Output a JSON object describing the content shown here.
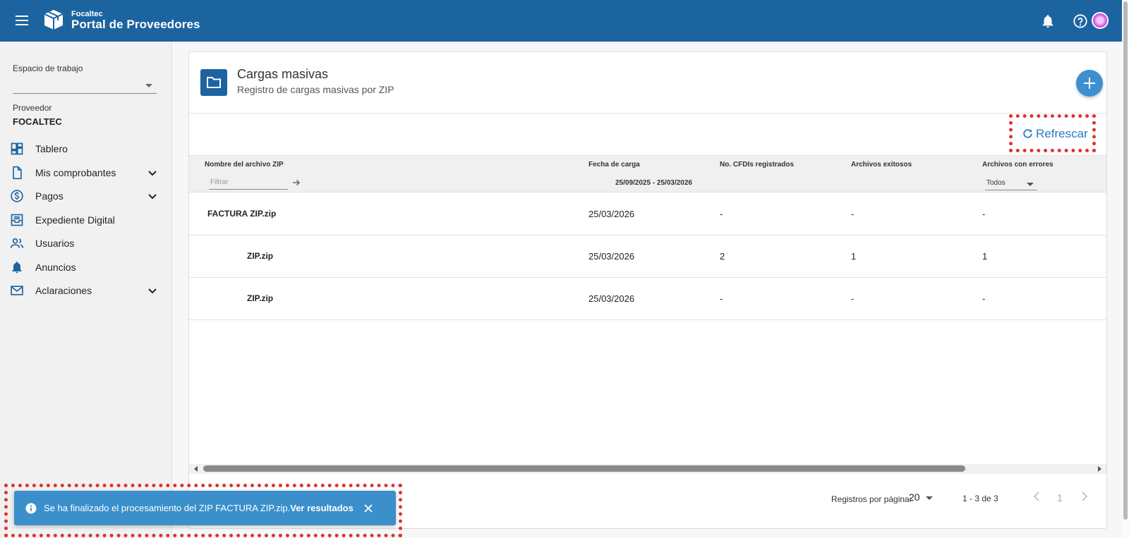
{
  "header": {
    "brand_small": "Focaltec",
    "brand_title": "Portal de Proveedores",
    "icons": [
      "menu-icon",
      "box-logo-icon",
      "bell-icon",
      "help-icon",
      "avatar"
    ]
  },
  "sidebar": {
    "workspace_label": "Espacio de trabajo",
    "workspace_value": "",
    "provider_label": "Proveedor",
    "provider_name": "FOCALTEC",
    "items": [
      {
        "label": "Tablero",
        "icon": "dashboard-icon",
        "expandable": false
      },
      {
        "label": "Mis comprobantes",
        "icon": "document-icon",
        "expandable": true
      },
      {
        "label": "Pagos",
        "icon": "dollar-coin-icon",
        "expandable": true
      },
      {
        "label": "Expediente Digital",
        "icon": "inbox-tray-icon",
        "expandable": false
      },
      {
        "label": "Usuarios",
        "icon": "users-icon",
        "expandable": false
      },
      {
        "label": "Anuncios",
        "icon": "bell-icon",
        "expandable": false
      },
      {
        "label": "Aclaraciones",
        "icon": "mail-icon",
        "expandable": true
      }
    ]
  },
  "card": {
    "title": "Cargas masivas",
    "subtitle": "Registro de cargas masivas por ZIP",
    "refresh_label": "Refrescar"
  },
  "table": {
    "columns": [
      "Nombre del archivo ZIP",
      "Fecha de carga",
      "No. CFDIs registrados",
      "Archivos exitosos",
      "Archivos con errores"
    ],
    "filter_placeholder": "Filtrar",
    "date_filter": "25/09/2025 - 25/03/2026",
    "errors_filter": "Todos",
    "rows": [
      {
        "name": "FACTURA ZIP.zip",
        "date": "25/03/2026",
        "cfdis": "-",
        "ok": "-",
        "errors": "-"
      },
      {
        "name": "ZIP.zip",
        "date": "25/03/2026",
        "cfdis": "2",
        "ok": "1",
        "errors": "1"
      },
      {
        "name": "ZIP.zip",
        "date": "25/03/2026",
        "cfdis": "-",
        "ok": "-",
        "errors": "-"
      }
    ]
  },
  "pagination": {
    "per_page_label": "Registros por página:",
    "per_page": "20",
    "range": "1 - 3 de 3",
    "current_page": "1"
  },
  "snackbar": {
    "message": "Se ha finalizado el procesamiento del ZIP FACTURA ZIP.zip.",
    "link": "Ver resultados"
  },
  "colors": {
    "header": "#1c64a0",
    "accent": "#3e8fd0",
    "snackbar": "#3b8fca",
    "highlight": "#e03131"
  }
}
